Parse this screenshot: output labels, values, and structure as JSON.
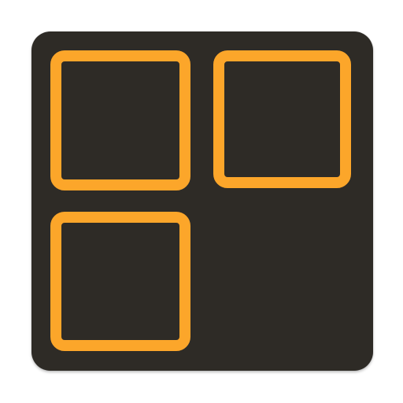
{
  "icon": {
    "name": "grid-layout-icon",
    "background_color": "#2e2b26",
    "accent_color": "#fca62a",
    "tiles": [
      "top-left",
      "top-right",
      "bottom-left"
    ]
  }
}
